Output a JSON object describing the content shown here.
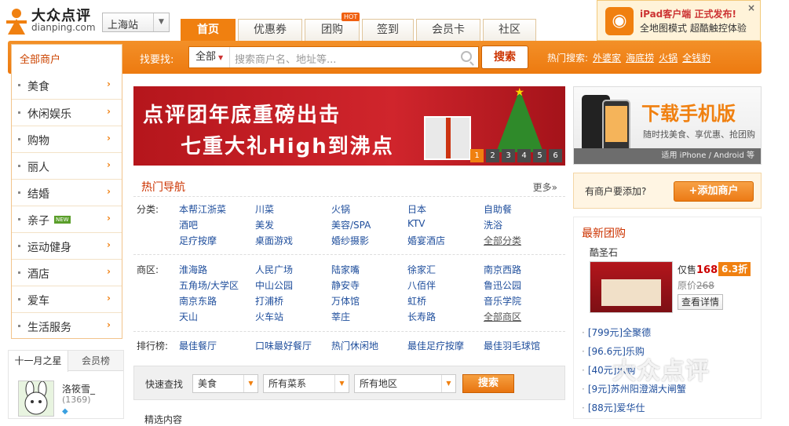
{
  "logo": {
    "cn": "大众点评",
    "en": "dianping.com"
  },
  "city": {
    "label": "上海站"
  },
  "nav_tabs": [
    {
      "label": "首页",
      "active": true
    },
    {
      "label": "优惠券"
    },
    {
      "label": "团购",
      "badge": "HOT"
    },
    {
      "label": "签到"
    },
    {
      "label": "会员卡"
    },
    {
      "label": "社区"
    }
  ],
  "promo": {
    "line1": "iPad客户端 正式发布!",
    "line2": "全地图模式 超酷触控体验",
    "close": "×"
  },
  "all_shops": "全部商户",
  "search": {
    "label": "找要找:",
    "category": "全部",
    "placeholder": "搜索商户名、地址等...",
    "button": "搜索"
  },
  "hot_search": {
    "label": "热门搜索:",
    "items": [
      "外婆家",
      "海底捞",
      "火锅",
      "全钱豹"
    ]
  },
  "left_nav": [
    {
      "label": "美食"
    },
    {
      "label": "休闲娱乐"
    },
    {
      "label": "购物"
    },
    {
      "label": "丽人"
    },
    {
      "label": "结婚"
    },
    {
      "label": "亲子",
      "badge": "NEW"
    },
    {
      "label": "运动健身"
    },
    {
      "label": "酒店"
    },
    {
      "label": "爱车"
    },
    {
      "label": "生活服务"
    }
  ],
  "star": {
    "tab1": "十一月之星",
    "tab2": "会员榜",
    "name": "洛筱雪_",
    "count": "(1369)"
  },
  "banner": {
    "line1": "点评团年底重磅出击",
    "line2": "七重大礼High到沸点",
    "pages": [
      "1",
      "2",
      "3",
      "4",
      "5",
      "6"
    ]
  },
  "hot_nav": {
    "title": "热门导航",
    "more": "更多»",
    "category_label": "分类:",
    "categories": [
      [
        "本帮江浙菜",
        "川菜",
        "火锅",
        "日本",
        "自助餐"
      ],
      [
        "酒吧",
        "美发",
        "美容/SPA",
        "KTV",
        "洗浴"
      ],
      [
        "足疗按摩",
        "桌面游戏",
        "婚纱摄影",
        "婚宴酒店",
        "全部分类"
      ]
    ],
    "district_label": "商区:",
    "districts": [
      [
        "淮海路",
        "人民广场",
        "陆家嘴",
        "徐家汇",
        "南京西路"
      ],
      [
        "五角场/大学区",
        "中山公园",
        "静安寺",
        "八佰伴",
        "鲁迅公园"
      ],
      [
        "南京东路",
        "打浦桥",
        "万体馆",
        "虹桥",
        "音乐学院"
      ],
      [
        "天山",
        "火车站",
        "莘庄",
        "长寿路",
        "全部商区"
      ]
    ],
    "rank_label": "排行榜:",
    "ranks": [
      "最佳餐厅",
      "口味最好餐厅",
      "热门休闲地",
      "最佳足疗按摩",
      "最佳羽毛球馆"
    ]
  },
  "quick_search": {
    "label": "快速查找",
    "sel1": "美食",
    "sel2": "所有菜系",
    "sel3": "所有地区",
    "button": "搜索"
  },
  "tail": "精选内容",
  "mobile": {
    "title": "下载手机版",
    "subtitle": "随时找美食、享优惠、抢团购",
    "platforms": "适用 iPhone / Android 等"
  },
  "add_shop": {
    "question": "有商户要添加?",
    "button": "+添加商户"
  },
  "deals": {
    "title": "最新团购",
    "shop": "酷圣石",
    "price_label": "仅售",
    "price": "168",
    "discount": "6.3折",
    "orig_label": "原价",
    "orig_price": "268",
    "view": "查看详情",
    "list": [
      "[799元]全聚德",
      "[96.6元]乐购",
      "[40元]乐购",
      "[9元]苏州阳澄湖大闸蟹",
      "[88元]爱华仕"
    ]
  },
  "watermark": "大众点评",
  "colors": {
    "brand_orange": "#f08010",
    "link_blue": "#1f4e9c",
    "title_red": "#cc3300"
  }
}
